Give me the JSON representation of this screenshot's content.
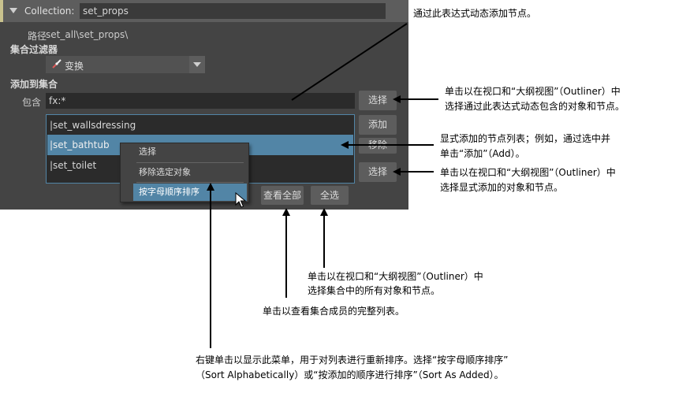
{
  "panel": {
    "header": {
      "label": "Collection:",
      "value": "set_props"
    },
    "path": {
      "label": "路径",
      "value": "set_all\\set_props\\"
    },
    "filter": {
      "label": "集合过滤器",
      "value": "变换"
    },
    "add_section": "添加到集合",
    "include": {
      "label": "包含",
      "value": "fx:*"
    },
    "buttons": {
      "select_expr": "选择",
      "add": "添加",
      "remove": "移除",
      "select_list": "选择",
      "view_all": "查看全部",
      "select_all": "全选"
    },
    "list": [
      "|set_wallsdressing",
      "|set_bathtub",
      "|set_toilet"
    ],
    "context_menu": [
      "选择",
      "移除选定对象",
      "按字母顺序排序"
    ]
  },
  "annotations": {
    "expr": "通过此表达式动态添加节点。",
    "select_expr": [
      "单击以在视口和“大纲视图”（Outliner）中",
      "选择通过此表达式动态包含的对象和节点。"
    ],
    "list": [
      "显式添加的节点列表；例如，通过选中并",
      "单击“添加”（Add）。"
    ],
    "select_list": [
      "单击以在视口和“大纲视图”（Outliner）中",
      "选择显式添加的对象和节点。"
    ],
    "select_all": [
      "单击以在视口和“大纲视图”（Outliner）中",
      "选择集合中的所有对象和节点。"
    ],
    "view_all": "单击以查看集合成员的完整列表。",
    "sort": [
      "右键单击以显示此菜单，用于对列表进行重新排序。选择“按字母顺序排序”",
      "（Sort Alphabetically）或“按添加的顺序进行排序”（Sort As Added）。"
    ]
  },
  "colors": {
    "panel_bg": "#444444",
    "field_bg": "#2b2b2b",
    "selection": "#5285a6",
    "header_accent": "#c9c28e"
  },
  "icons": [
    "transform-icon",
    "dropdown-arrow-icon",
    "collapse-triangle-icon",
    "mouse-cursor-icon"
  ]
}
